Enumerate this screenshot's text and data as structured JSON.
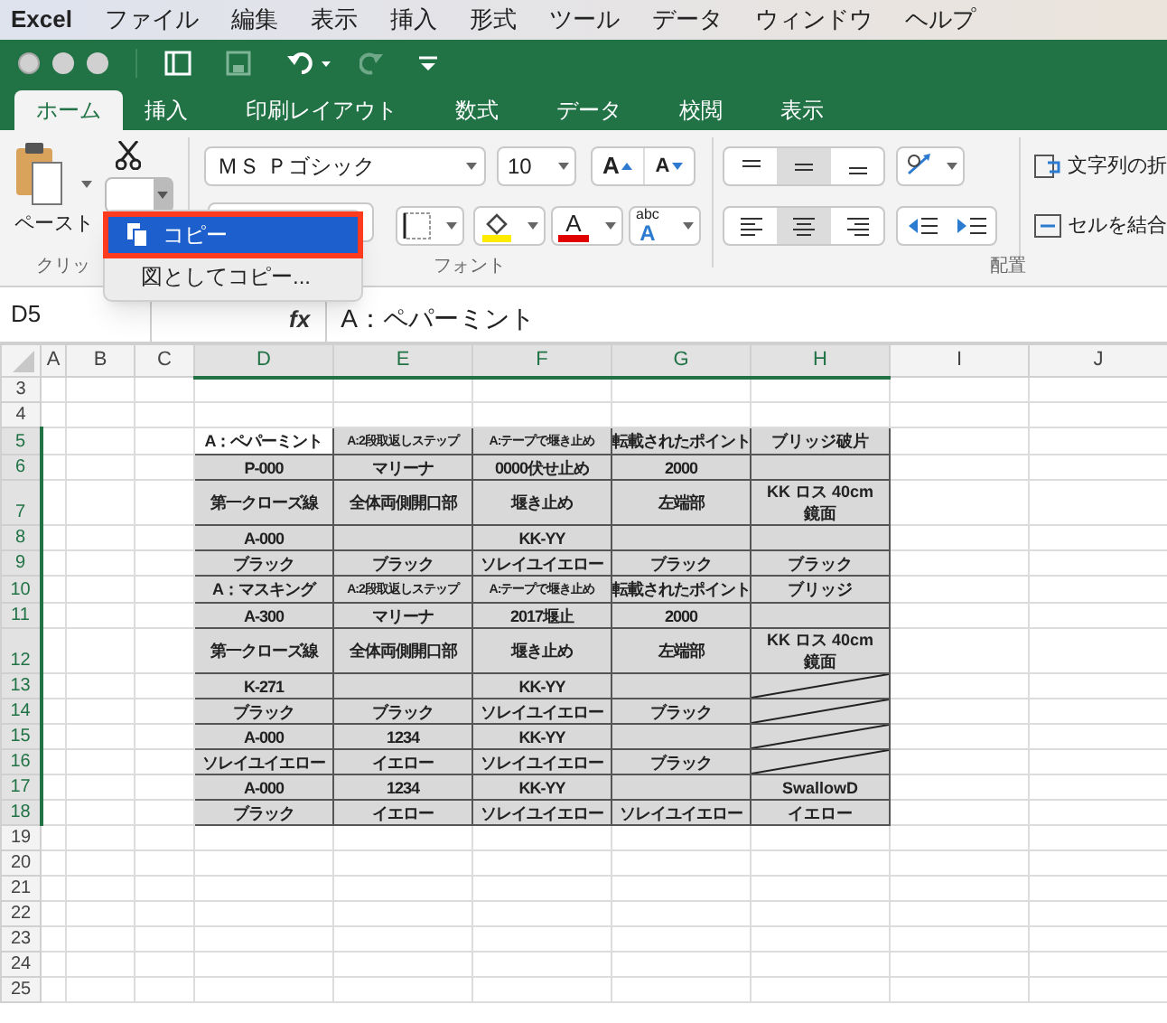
{
  "menubar": {
    "app": "Excel",
    "items": [
      "ファイル",
      "編集",
      "表示",
      "挿入",
      "形式",
      "ツール",
      "データ",
      "ウィンドウ",
      "ヘルプ"
    ]
  },
  "tabs": [
    {
      "label": "ホーム",
      "selected": true
    },
    {
      "label": "挿入",
      "selected": false
    },
    {
      "label": "印刷レイアウト",
      "selected": false
    },
    {
      "label": "数式",
      "selected": false
    },
    {
      "label": "データ",
      "selected": false
    },
    {
      "label": "校閲",
      "selected": false
    },
    {
      "label": "表示",
      "selected": false
    }
  ],
  "ribbon": {
    "paste": "ペースト",
    "font_name": "ＭＳ Ｐゴシック",
    "font_size": "10",
    "grow": "A",
    "shrink": "A",
    "font_color": "A",
    "phonetic_top": "abc",
    "phonetic_bottom": "A",
    "wrap_text": "文字列の折",
    "merge": "セルを結合",
    "groups": [
      "クリッ",
      "フォント",
      "配置"
    ]
  },
  "menu": [
    {
      "label": "コピー",
      "selected": true
    },
    {
      "label": "図としてコピー...",
      "selected": false
    }
  ],
  "formula_bar": {
    "name_box": "D5",
    "fx": "fx",
    "content": "A：ペパーミント"
  },
  "sheet": {
    "columns": [
      {
        "label": "A",
        "selected": false
      },
      {
        "label": "B",
        "selected": false
      },
      {
        "label": "C",
        "selected": false
      },
      {
        "label": "D",
        "selected": true
      },
      {
        "label": "E",
        "selected": true
      },
      {
        "label": "F",
        "selected": true
      },
      {
        "label": "G",
        "selected": true
      },
      {
        "label": "H",
        "selected": true
      },
      {
        "label": "I",
        "selected": false
      },
      {
        "label": "J",
        "selected": false
      }
    ],
    "rows": [
      {
        "label": "3",
        "selected": false
      },
      {
        "label": "4",
        "selected": false
      },
      {
        "label": "5",
        "selected": true,
        "active_first": true,
        "slashed": false,
        "cells": [
          "A：ペパーミント",
          "A:2段取返しステップ",
          "A:テープで堰き止め",
          "転載されたポイント",
          "ブリッジ破片"
        ]
      },
      {
        "label": "6",
        "selected": true,
        "active_first": false,
        "slashed": false,
        "cells": [
          "P-000",
          "マリーナ",
          "0000伏せ止め",
          "2000",
          null
        ]
      },
      {
        "label": "7",
        "selected": true,
        "active_first": false,
        "slashed": false,
        "cells": [
          "第一クローズ線",
          "全体両側開口部",
          "堰き止め",
          "左端部",
          "KK ロス 40cm 鏡面"
        ]
      },
      {
        "label": "8",
        "selected": true,
        "active_first": false,
        "slashed": false,
        "cells": [
          "A-000",
          null,
          "KK-YY",
          null,
          null
        ]
      },
      {
        "label": "9",
        "selected": true,
        "active_first": false,
        "slashed": false,
        "cells": [
          "ブラック",
          "ブラック",
          "ソレイユイエロー",
          "ブラック",
          "ブラック"
        ]
      },
      {
        "label": "10",
        "selected": true,
        "active_first": false,
        "slashed": false,
        "cells": [
          "A：マスキング",
          "A:2段取返しステップ",
          "A:テープで堰き止め",
          "転載されたポイント",
          "ブリッジ"
        ]
      },
      {
        "label": "11",
        "selected": true,
        "active_first": false,
        "slashed": false,
        "cells": [
          "A-300",
          "マリーナ",
          "2017堰止",
          "2000",
          null
        ]
      },
      {
        "label": "12",
        "selected": true,
        "active_first": false,
        "slashed": false,
        "cells": [
          "第一クローズ線",
          "全体両側開口部",
          "堰き止め",
          "左端部",
          "KK ロス 40cm 鏡面"
        ]
      },
      {
        "label": "13",
        "selected": true,
        "active_first": false,
        "slashed": true,
        "cells": [
          "K-271",
          null,
          "KK-YY",
          null,
          null
        ]
      },
      {
        "label": "14",
        "selected": true,
        "active_first": false,
        "slashed": true,
        "cells": [
          "ブラック",
          "ブラック",
          "ソレイユイエロー",
          "ブラック",
          null
        ]
      },
      {
        "label": "15",
        "selected": true,
        "active_first": false,
        "slashed": true,
        "cells": [
          "A-000",
          "1234",
          "KK-YY",
          null,
          null
        ]
      },
      {
        "label": "16",
        "selected": true,
        "active_first": false,
        "slashed": true,
        "cells": [
          "ソレイユイエロー",
          "イエロー",
          "ソレイユイエロー",
          "ブラック",
          null
        ]
      },
      {
        "label": "17",
        "selected": true,
        "active_first": false,
        "slashed": false,
        "cells": [
          "A-000",
          "1234",
          "KK-YY",
          null,
          "SwallowD"
        ]
      },
      {
        "label": "18",
        "selected": true,
        "active_first": false,
        "slashed": false,
        "cells": [
          "ブラック",
          "イエロー",
          "ソレイユイエロー",
          "ソレイユイエロー",
          "イエロー"
        ]
      },
      {
        "label": "19",
        "selected": false
      },
      {
        "label": "20",
        "selected": false
      },
      {
        "label": "21",
        "selected": false
      },
      {
        "label": "22",
        "selected": false
      },
      {
        "label": "23",
        "selected": false
      },
      {
        "label": "24",
        "selected": false
      },
      {
        "label": "25",
        "selected": false
      }
    ]
  }
}
